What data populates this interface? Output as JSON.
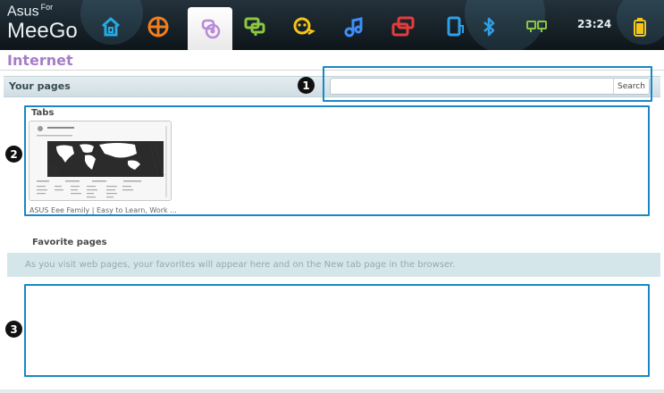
{
  "logo": {
    "line1": "Asus",
    "line1_suffix": "For",
    "line2": "MeeGo"
  },
  "taskbar": {
    "icons": [
      "home-icon",
      "globe-grid-icon",
      "internet-icon",
      "chat-icon",
      "people-icon",
      "music-icon",
      "windows-icon",
      "device-icon",
      "bluetooth-icon",
      "network-icon",
      "battery-icon"
    ],
    "clock": "23:24",
    "colors": {
      "home": "#27a9e1",
      "grid": "#f07e1f",
      "internet": "#b78bd8",
      "chat": "#8dc63f",
      "people": "#f5c518",
      "music": "#3e8ef7",
      "windows": "#e73b3b",
      "device": "#2f9fe8",
      "bluetooth": "#2f9fe8",
      "network": "#8dc63f",
      "battery": "#f5c518"
    }
  },
  "page": {
    "title": "Internet"
  },
  "your_pages": {
    "label": "Your pages",
    "search": {
      "value": "",
      "placeholder": "",
      "button_label": "Search"
    }
  },
  "tabs": {
    "label": "Tabs",
    "items": [
      {
        "caption": "ASUS Eee Family | Easy to Learn, Work ..."
      }
    ]
  },
  "favorites": {
    "label": "Favorite pages",
    "empty_message": "As you visit web pages, your favorites will appear here and on the New tab page in the browser."
  },
  "callouts": [
    "1",
    "2",
    "3"
  ],
  "accent": {
    "frame": "#1a87c4",
    "title": "#a67dc9"
  }
}
